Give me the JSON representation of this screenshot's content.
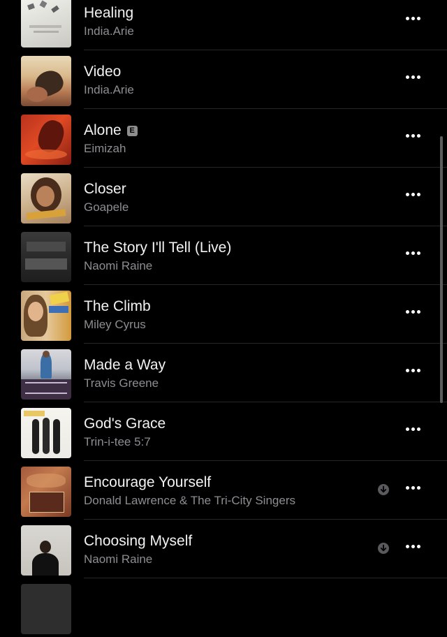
{
  "songs": [
    {
      "title": "Healing",
      "artist": "India.Arie",
      "explicit": false,
      "downloaded": false,
      "art_icon": "album-art-healing"
    },
    {
      "title": "Video",
      "artist": "India.Arie",
      "explicit": false,
      "downloaded": false,
      "art_icon": "album-art-video"
    },
    {
      "title": "Alone",
      "artist": "Eimizah",
      "explicit": true,
      "explicit_label": "E",
      "downloaded": false,
      "art_icon": "album-art-alone"
    },
    {
      "title": "Closer",
      "artist": "Goapele",
      "explicit": false,
      "downloaded": false,
      "art_icon": "album-art-closer"
    },
    {
      "title": "The Story I'll Tell (Live)",
      "artist": "Naomi Raine",
      "explicit": false,
      "downloaded": false,
      "art_icon": "album-art-the-story-ill-tell"
    },
    {
      "title": "The Climb",
      "artist": "Miley Cyrus",
      "explicit": false,
      "downloaded": false,
      "art_icon": "album-art-the-climb"
    },
    {
      "title": "Made a Way",
      "artist": "Travis Greene",
      "explicit": false,
      "downloaded": false,
      "art_icon": "album-art-made-a-way"
    },
    {
      "title": "God's Grace",
      "artist": "Trin-i-tee 5:7",
      "explicit": false,
      "downloaded": false,
      "art_icon": "album-art-gods-grace"
    },
    {
      "title": "Encourage Yourself",
      "artist": "Donald Lawrence & The Tri-City Singers",
      "explicit": false,
      "downloaded": true,
      "art_icon": "album-art-encourage-yourself"
    },
    {
      "title": "Choosing Myself",
      "artist": "Naomi Raine",
      "explicit": false,
      "downloaded": true,
      "art_icon": "album-art-choosing-myself"
    }
  ],
  "icons": {
    "more": "ellipsis-icon",
    "downloaded": "downloaded-arrow-icon"
  },
  "colors": {
    "background": "#000000",
    "title_text": "#f2f2f2",
    "subtitle_text": "#8d8d92",
    "separator": "#262626"
  }
}
